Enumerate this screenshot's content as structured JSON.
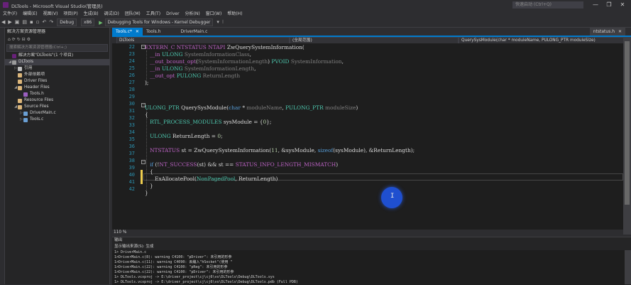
{
  "window": {
    "title": "DLTools - Microsoft Visual Studio(管理员)",
    "quick_launch_placeholder": "快速启动 (Ctrl+Q)",
    "minimize": "—",
    "maximize": "❐",
    "close": "✕"
  },
  "menu": [
    "文件(F)",
    "编辑(E)",
    "视图(V)",
    "项目(P)",
    "生成(B)",
    "调试(D)",
    "团队(M)",
    "工具(T)",
    "Driver",
    "分析(N)",
    "窗口(W)",
    "帮助(H)"
  ],
  "toolbar": {
    "config": "Debug",
    "platform": "x86",
    "debugger": "Debugging Tools for Windows - Kernel Debugger"
  },
  "solution_explorer": {
    "title": "解决方案资源管理器",
    "search_placeholder": "搜索解决方案资源管理器(Ctrl+;)",
    "items": [
      {
        "label": "解决方案\"DLTools\"(1 个项目)",
        "level": 0,
        "toggle": "",
        "icon": "solution",
        "color": "#68217a"
      },
      {
        "label": "DLTools",
        "level": 0,
        "toggle": "◢",
        "icon": "project",
        "color": "#9b9b9b"
      },
      {
        "label": "引用",
        "level": 1,
        "toggle": "▷",
        "icon": "references",
        "color": "#c0c0c0"
      },
      {
        "label": "外部依赖项",
        "level": 1,
        "toggle": "",
        "icon": "folder",
        "color": "#dcb67a"
      },
      {
        "label": "Driver Files",
        "level": 1,
        "toggle": "",
        "icon": "folder",
        "color": "#dcb67a"
      },
      {
        "label": "Header Files",
        "level": 1,
        "toggle": "◢",
        "icon": "folder",
        "color": "#dcb67a"
      },
      {
        "label": "Tools.h",
        "level": 2,
        "toggle": "",
        "icon": "header-file",
        "color": "#9b5fc0"
      },
      {
        "label": "Resource Files",
        "level": 1,
        "toggle": "",
        "icon": "folder",
        "color": "#dcb67a"
      },
      {
        "label": "Source Files",
        "level": 1,
        "toggle": "◢",
        "icon": "folder",
        "color": "#dcb67a"
      },
      {
        "label": "DriverMain.c",
        "level": 2,
        "toggle": "▷",
        "icon": "c-file",
        "color": "#6a9fd4"
      },
      {
        "label": "Tools.c",
        "level": 2,
        "toggle": "▷",
        "icon": "c-file",
        "color": "#6a9fd4"
      }
    ]
  },
  "tabs": [
    {
      "label": "Tools.c*",
      "close": "✕",
      "active": true
    },
    {
      "label": "Tools.h",
      "close": "",
      "active": false
    },
    {
      "label": "DriverMain.c",
      "close": "",
      "active": false
    }
  ],
  "pinned_tab": {
    "label": "ntstatus.h",
    "close": "✕"
  },
  "navbar": {
    "project": "DLTools",
    "scope": "(全局范围)",
    "member": "QuerySysModule(char * moduleName, PULONG_PTR moduleSize)"
  },
  "editor": {
    "line_numbers": [
      "22",
      "23",
      "24",
      "25",
      "26",
      "27",
      "28",
      "29",
      "30",
      "31",
      "32",
      "33",
      "34",
      "35",
      "36",
      "37",
      "38",
      "39",
      "40",
      "41",
      "42"
    ],
    "zoom": "110 %"
  },
  "output": {
    "title": "输出",
    "source_label": "显示输出来源(S): 生成",
    "lines": [
      "1>  DriverMain.c",
      "1>DriverMain.c(8): warning C4100: \"pDriver\": 未引用的形参",
      "1>DriverMain.c(11): warning C4090: 丟编入\"hSocket\"(使用 \"",
      "1>DriverMain.c(22): warning C4100: \"pReg\": 未引用的形参",
      "1>DriverMain.c(22): warning C4100: \"pDriver\": 未引用的形参",
      "1>  DLTools.vcxproj -> E:\\driver_project\\cj\\cj6\\vs\\DLTools\\Debug\\DLTools.sys",
      "1>  DLTools.vcxproj -> E:\\driver_project\\cj\\cj6\\vs\\DLTools\\Debug\\DLTools.pdb (Full PDB)"
    ]
  }
}
